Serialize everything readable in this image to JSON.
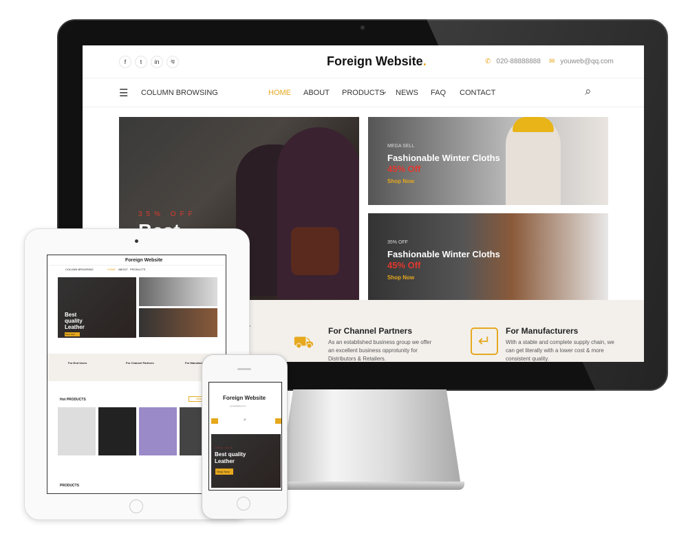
{
  "site": {
    "logo": "Foreign Website",
    "logo_dot": ".",
    "social": [
      "f",
      "t",
      "in",
      "ig"
    ],
    "phone": "020-88888888",
    "email": "youweb@qq.com",
    "column_browsing": "COLUMN BROWSING",
    "nav": [
      "HOME",
      "ABOUT",
      "PRODUCTS",
      "NEWS",
      "FAQ",
      "CONTACT"
    ],
    "products_caret": "⌄",
    "accent": "#e6a81d",
    "sale_red": "#e2382d"
  },
  "hero": {
    "discount": "35% OFF",
    "title": "Best quality Leather",
    "title_visible": "Best",
    "cta": "Shop Now"
  },
  "banners": [
    {
      "tag": "MEGA SELL",
      "title": "Fashionable Winter Cloths",
      "highlight": "45% Off",
      "cta": "Shop Now"
    },
    {
      "tag": "35% OFF",
      "title": "Fashionable Winter Cloths",
      "highlight": "45% Off",
      "cta": "Shop Now"
    }
  ],
  "features": [
    {
      "title": "For End Users",
      "text": "...ion, ...st"
    },
    {
      "title": "For Channel Partners",
      "text": "As an established business group we offer an excellent business opprotunity for Distributors & Retailers."
    },
    {
      "title": "For Manufacturers",
      "text": "With a stable and complete supply chain, we can get literally with a lower cost & more consistent quality."
    }
  ],
  "tablet": {
    "hot_products": "Hot PRODUCTS",
    "products": "PRODUCTS",
    "view_more": "View More",
    "hero_lines": [
      "Best",
      "quality",
      "Leather"
    ],
    "shop_now": "Shop Now"
  },
  "phone": {
    "hero_lines": [
      "Best quality",
      "Leather"
    ],
    "discount": "35% OFF",
    "shop_now": "Shop Now"
  }
}
